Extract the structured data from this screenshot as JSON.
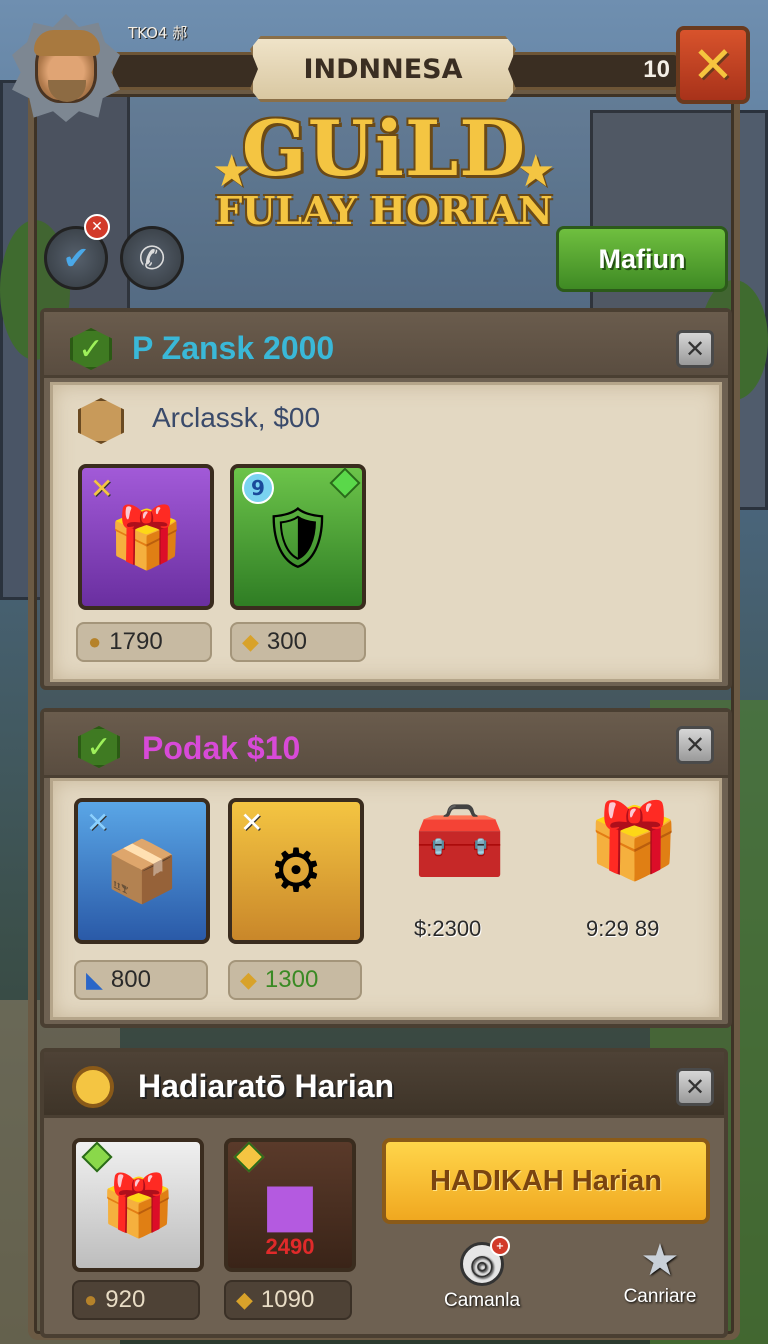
{
  "header": {
    "small_title": "TKO4 郝",
    "banner_text": "INDNNESA",
    "count": "10",
    "close_icon": "x-icon"
  },
  "title": {
    "main": "GUiLD",
    "sub": "FULAY HORIAN"
  },
  "actions": {
    "check_icon": "check-icon",
    "call_icon": "phone-icon",
    "green_button": "Mafiun"
  },
  "panels": [
    {
      "title": "P Zansk 2000",
      "subtitle": "Arclassk, $00",
      "items": [
        {
          "price": "1790",
          "icon": "gift-bundle"
        },
        {
          "price": "300",
          "icon": "hero-warrior"
        }
      ]
    },
    {
      "title": "Podak $10",
      "items": [
        {
          "price": "800",
          "icon": "treasure-chest"
        },
        {
          "price": "1300",
          "icon": "magic-device"
        },
        {
          "label": "$:2300",
          "icon": "gold-crate"
        },
        {
          "label": "9:29 89",
          "icon": "blue-gift"
        }
      ]
    },
    {
      "title": "Hadiaratō Harian",
      "items": [
        {
          "price": "920",
          "icon": "gift-box"
        },
        {
          "price": "1090",
          "inner_label": "2490",
          "icon": "purple-cube"
        }
      ],
      "action_button": "HADIKAH Harian"
    }
  ],
  "bottom_nav": [
    {
      "label": "Camanla",
      "icon": "compass-icon"
    },
    {
      "label": "Canriare",
      "icon": "star-icon"
    }
  ],
  "colors": {
    "frame": "#6b5a44",
    "gold": "#f4c542",
    "green": "#3f8a24",
    "red": "#d23a2a"
  }
}
